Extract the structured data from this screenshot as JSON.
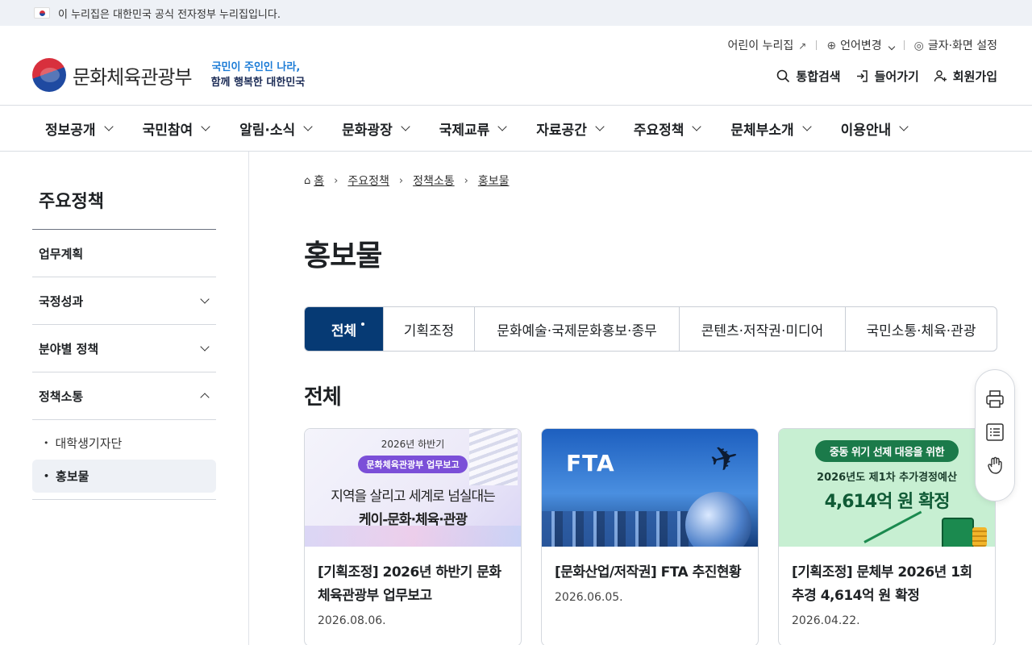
{
  "gov_banner": {
    "text": "이 누리집은 대한민국 공식 전자정부 누리집입니다."
  },
  "header": {
    "logo_text": "문화체육관광부",
    "slogan_line1": "국민이 주인인 나라,",
    "slogan_line2": "함께 행복한 대한민국",
    "util": {
      "kids": "어린이 누리집",
      "language": "언어변경",
      "display": "글자·화면 설정"
    },
    "actions": {
      "search": "통합검색",
      "login": "들어가기",
      "signup": "회원가입"
    }
  },
  "gnb": [
    "정보공개",
    "국민참여",
    "알림·소식",
    "문화광장",
    "국제교류",
    "자료공간",
    "주요정책",
    "문체부소개",
    "이용안내"
  ],
  "lnb": {
    "title": "주요정책",
    "items": [
      "업무계획",
      "국정성과",
      "분야별 정책",
      "정책소통"
    ],
    "sub_items": [
      "대학생기자단",
      "홍보물"
    ]
  },
  "breadcrumb": [
    "홈",
    "주요정책",
    "정책소통",
    "홍보물"
  ],
  "page_title": "홍보물",
  "tabs": [
    "전체",
    "기획조정",
    "문화예술·국제문화홍보·종무",
    "콘텐츠·저작권·미디어",
    "국민소통·체육·관광"
  ],
  "section_title": "전체",
  "cards": [
    {
      "title": "[기획조정] 2026년 하반기 문화체육관광부 업무보고",
      "date": "2026.08.06.",
      "thumb": {
        "year": "2026년 하반기",
        "pill": "문화체육관광부 업무보고",
        "line1": "지역을 살리고 세계로 넘실대는",
        "line2": "케이-문화·체육·관광"
      }
    },
    {
      "title": "[문화산업/저작권] FTA 추진현황",
      "date": "2026.06.05.",
      "thumb": {
        "label": "FTA"
      }
    },
    {
      "title": "[기획조정] 문체부 2026년 1회 추경 4,614억 원 확정",
      "date": "2026.04.22.",
      "thumb": {
        "pill": "중동 위기 선제 대응을 위한",
        "line1": "2026년도 제1차 추가경정예산",
        "line2": "4,614억 원 확정"
      }
    }
  ]
}
